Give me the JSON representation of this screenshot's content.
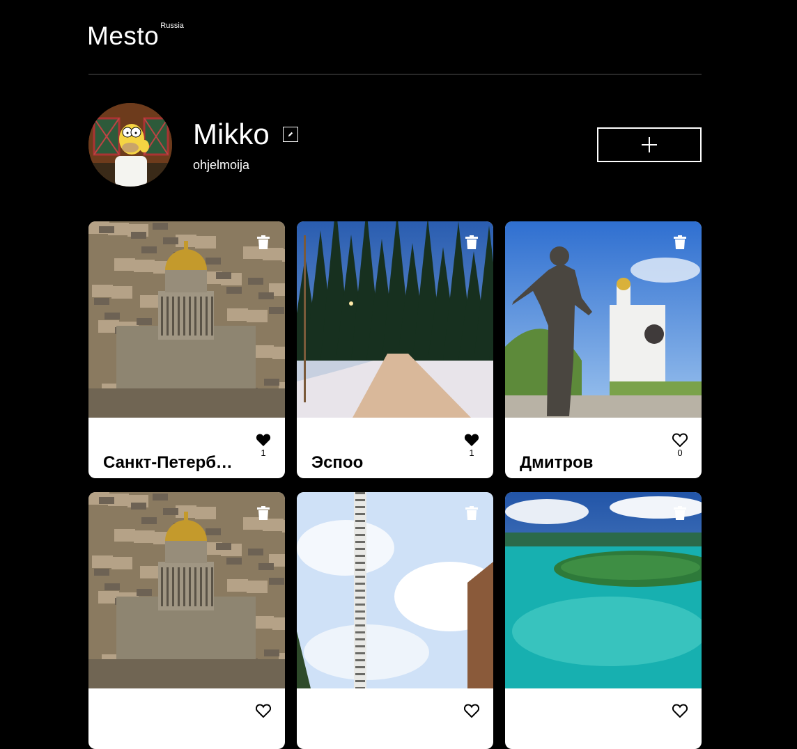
{
  "header": {
    "logo": "Mesto",
    "logo_sup": "Russia"
  },
  "profile": {
    "name": "Mikko",
    "about": "ohjelmoija"
  },
  "cards": [
    {
      "title": "Санкт-Петербург",
      "likes": "1",
      "liked": true,
      "scene": "spb"
    },
    {
      "title": "Эспоо",
      "likes": "1",
      "liked": true,
      "scene": "espoo"
    },
    {
      "title": "Дмитров",
      "likes": "0",
      "liked": false,
      "scene": "dmitrov"
    },
    {
      "scene": "spb"
    },
    {
      "scene": "tower"
    },
    {
      "scene": "island"
    }
  ]
}
